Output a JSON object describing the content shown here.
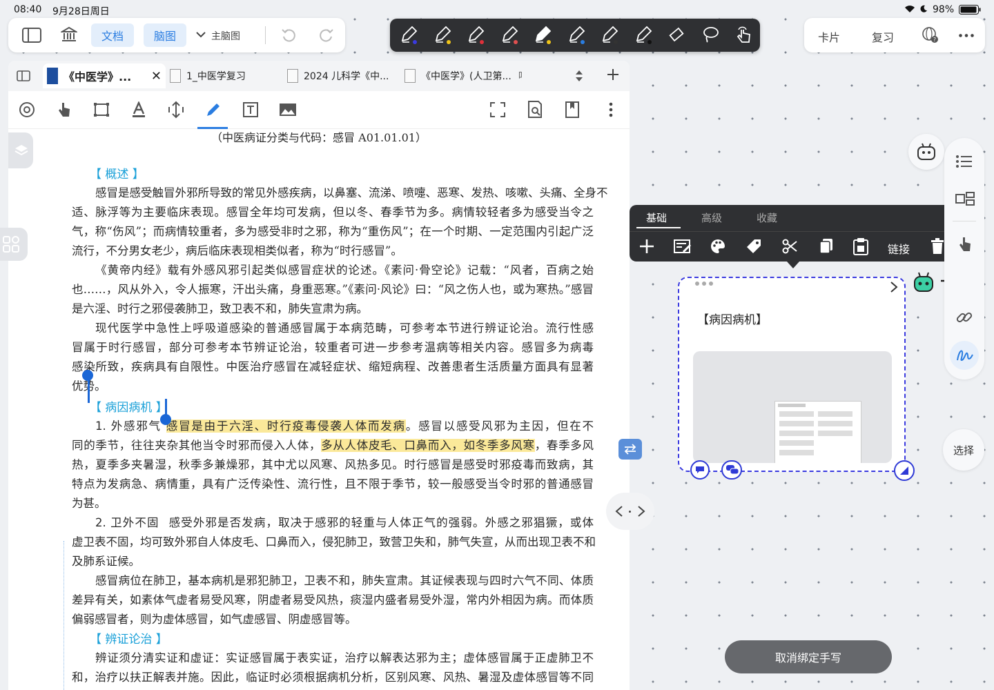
{
  "status_bar": {
    "time": "08:40",
    "date": "9月28日周日",
    "battery": "98%"
  },
  "top_left_toolbar": {
    "document_label": "文档",
    "mindmap_label": "脑图",
    "main_mindmap_label": "主脑图"
  },
  "pen_toolbar": {
    "tools": [
      "fountain-pen-icon",
      "pen-icon",
      "pen-red-icon",
      "highlighter-icon",
      "marker-icon",
      "highlighter-blue-icon",
      "pencil-icon",
      "brush-icon",
      "eraser-icon",
      "lasso-icon",
      "touch-icon"
    ]
  },
  "top_right_toolbar": {
    "card_label": "卡片",
    "review_label": "复习"
  },
  "tabs": [
    {
      "label": "《中医学》..."
    },
    {
      "label": "1_中医学复习"
    },
    {
      "label": "2024 儿科学《中..."
    },
    {
      "label": "《中医学》(人卫第..."
    },
    {
      "label": "听"
    }
  ],
  "document": {
    "title_line": "（中医病证分类与代码：感冒 A01.01.01）",
    "section_overview": "【 概述 】",
    "overview_lines": [
      "感冒是感受触冒外邪所导致的常见外感疾病，以鼻塞、流涕、喷嚏、恶寒、发热、咳嗽、头痛、全身不",
      "适、脉浮等为主要临床表现。感冒全年均可发病，但以冬、春季节为多。病情较轻者多为感受当令之",
      "气，称“伤风”；而病情较重者，多为感受非时之邪，称为“重伤风”；在一个时期、一定范围内引起广泛",
      "流行，不分男女老少，病后临床表现相类似者，称为“时行感冒”。",
      "《黄帝内经》载有外感风邪引起类似感冒症状的论述。《素问·骨空论》记载：“风者，百病之始",
      "也……，风从外入，令人振寒，汗出头痛，身重恶寒。”《素问·风论》曰：“风之伤人也，或为寒热。”感冒",
      "是六淫、时行之邪侵袭肺卫，致卫表不和，肺失宣肃为病。",
      "现代医学中急性上呼吸道感染的普通感冒属于本病范畴，可参考本节进行辨证论治。流行性感",
      "冒属于时行感冒，部分可参考本节辨证论治，较重者可进一步参考温病等相关内容。感冒多为病毒",
      "感染所致，疾病具有自限性。中医治疗感冒在减轻症状、缩短病程、改善患者生活质量方面具有显著",
      "优势。"
    ],
    "section_etiology": "【 病因病机 】",
    "item1_label": "1. 外感邪气",
    "item1_highlight": "感冒是由于六淫、时行疫毒侵袭人体而发病",
    "item1_rest": "。感冒以感受风邪为主因，但在不",
    "item1_line2_pre": "同的季节，往往夹杂其他当令时邪而侵入人体，",
    "item1_line2_hl": "多从人体皮毛、口鼻而入，如冬季多风寒",
    "item1_line2_post": "，春季多风",
    "item1_lines": [
      "热，夏季多夹暑湿，秋季多兼燥邪，其中尤以风寒、风热多见。时行感冒是感受时邪疫毒而致病，其",
      "特点为发病急、病情重，具有广泛传染性、流行性，且不限于季节，较一般感受当令时邪的普通感冒",
      "为甚。"
    ],
    "item2_label": "2. 卫外不固",
    "item2_first": "感受外邪是否发病，取决于感邪的轻重与人体正气的强弱。外感之邪猖獗，或体",
    "item2_lines": [
      "虚卫表不固，均可致外邪自人体皮毛、口鼻而入，侵犯肺卫，致营卫失和，肺气失宣，从而出现卫表不和",
      "及肺系证候。",
      "感冒病位在肺卫，基本病机是邪犯肺卫，卫表不和，肺失宣肃。其证候表现与四时六气不同、体质",
      "差异有关，如素体气虚者易受风寒，阴虚者易受风热，痰湿内盛者易受外湿，常内外相因为病。而体质",
      "偏弱感冒者，则为虚体感冒，如气虚感冒、阴虚感冒等。"
    ],
    "section_treatment": "【 辨证论治 】",
    "treatment_lines": [
      "辨证须分清实证和虚证：实证感冒属于表实证，治疗以解表达邪为主；虚体感冒属于正虚肺卫不",
      "和，治疗以扶正解表并施。因此，临证时必须根据病机分析，区别风寒、风热、暑湿及虚体感冒等不同"
    ]
  },
  "context_menu": {
    "tabs": [
      "基础",
      "高级",
      "收藏"
    ],
    "link_label": "链接"
  },
  "card": {
    "title": "【病因病机】"
  },
  "right_rail": {
    "select_label": "选择"
  },
  "unbind_button_label": "取消绑定手写"
}
